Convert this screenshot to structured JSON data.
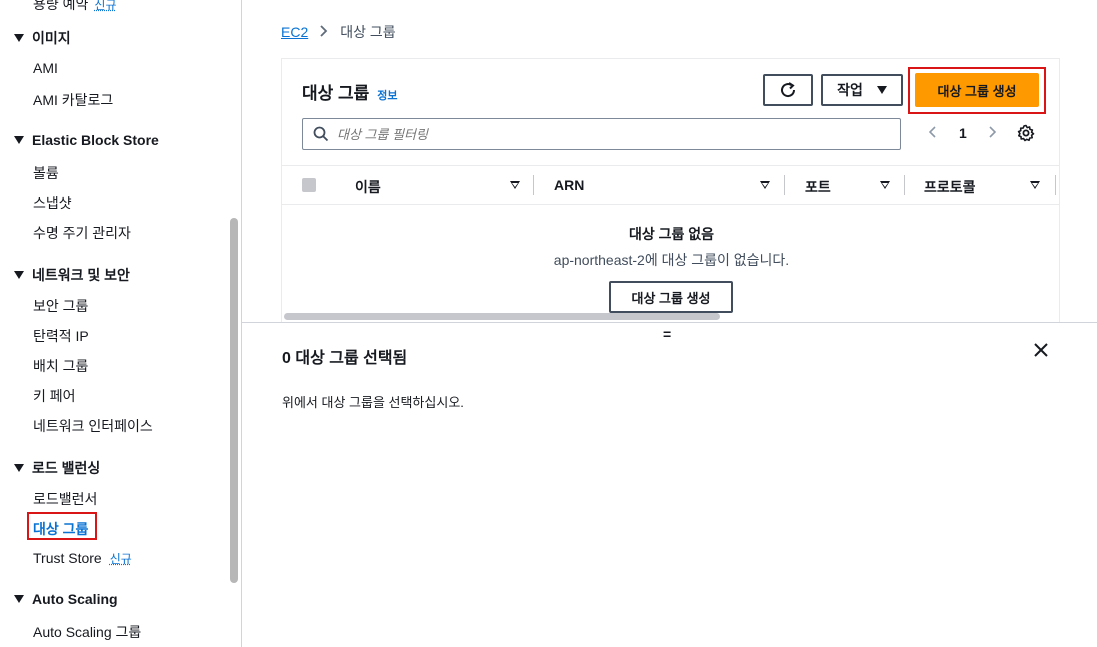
{
  "sidebar": {
    "top_partial": {
      "label": "용량 예약",
      "badge": "신규"
    },
    "sections": [
      {
        "label": "이미지",
        "items": [
          "AMI",
          "AMI 카탈로그"
        ]
      },
      {
        "label": "Elastic Block Store",
        "items": [
          "볼륨",
          "스냅샷",
          "수명 주기 관리자"
        ]
      },
      {
        "label": "네트워크 및 보안",
        "items": [
          "보안 그룹",
          "탄력적 IP",
          "배치 그룹",
          "키 페어",
          "네트워크 인터페이스"
        ]
      },
      {
        "label": "로드 밸런싱",
        "items": [
          "로드밸런서",
          "대상 그룹",
          "Trust Store"
        ],
        "badge": "신규"
      },
      {
        "label": "Auto Scaling",
        "items": [
          "Auto Scaling 그룹"
        ]
      }
    ],
    "active_item": "대상 그룹"
  },
  "breadcrumb": {
    "root": "EC2",
    "current": "대상 그룹"
  },
  "panel": {
    "title": "대상 그룹",
    "info_link": "정보",
    "actions_label": "작업",
    "create_label": "대상 그룹 생성",
    "search_placeholder": "대상 그룹 필터링",
    "page": "1",
    "columns": [
      "이름",
      "ARN",
      "포트",
      "프로토콜"
    ],
    "empty_title": "대상 그룹 없음",
    "empty_desc": "ap-northeast-2에 대상 그룹이 없습니다.",
    "empty_button": "대상 그룹 생성"
  },
  "split_handle": "=",
  "detail": {
    "title": "0 대상 그룹 선택됨",
    "message": "위에서 대상 그룹을 선택하십시오."
  },
  "colors": {
    "accent": "#0972d3",
    "primary_button": "#ff9900",
    "highlight": "#d91515"
  }
}
